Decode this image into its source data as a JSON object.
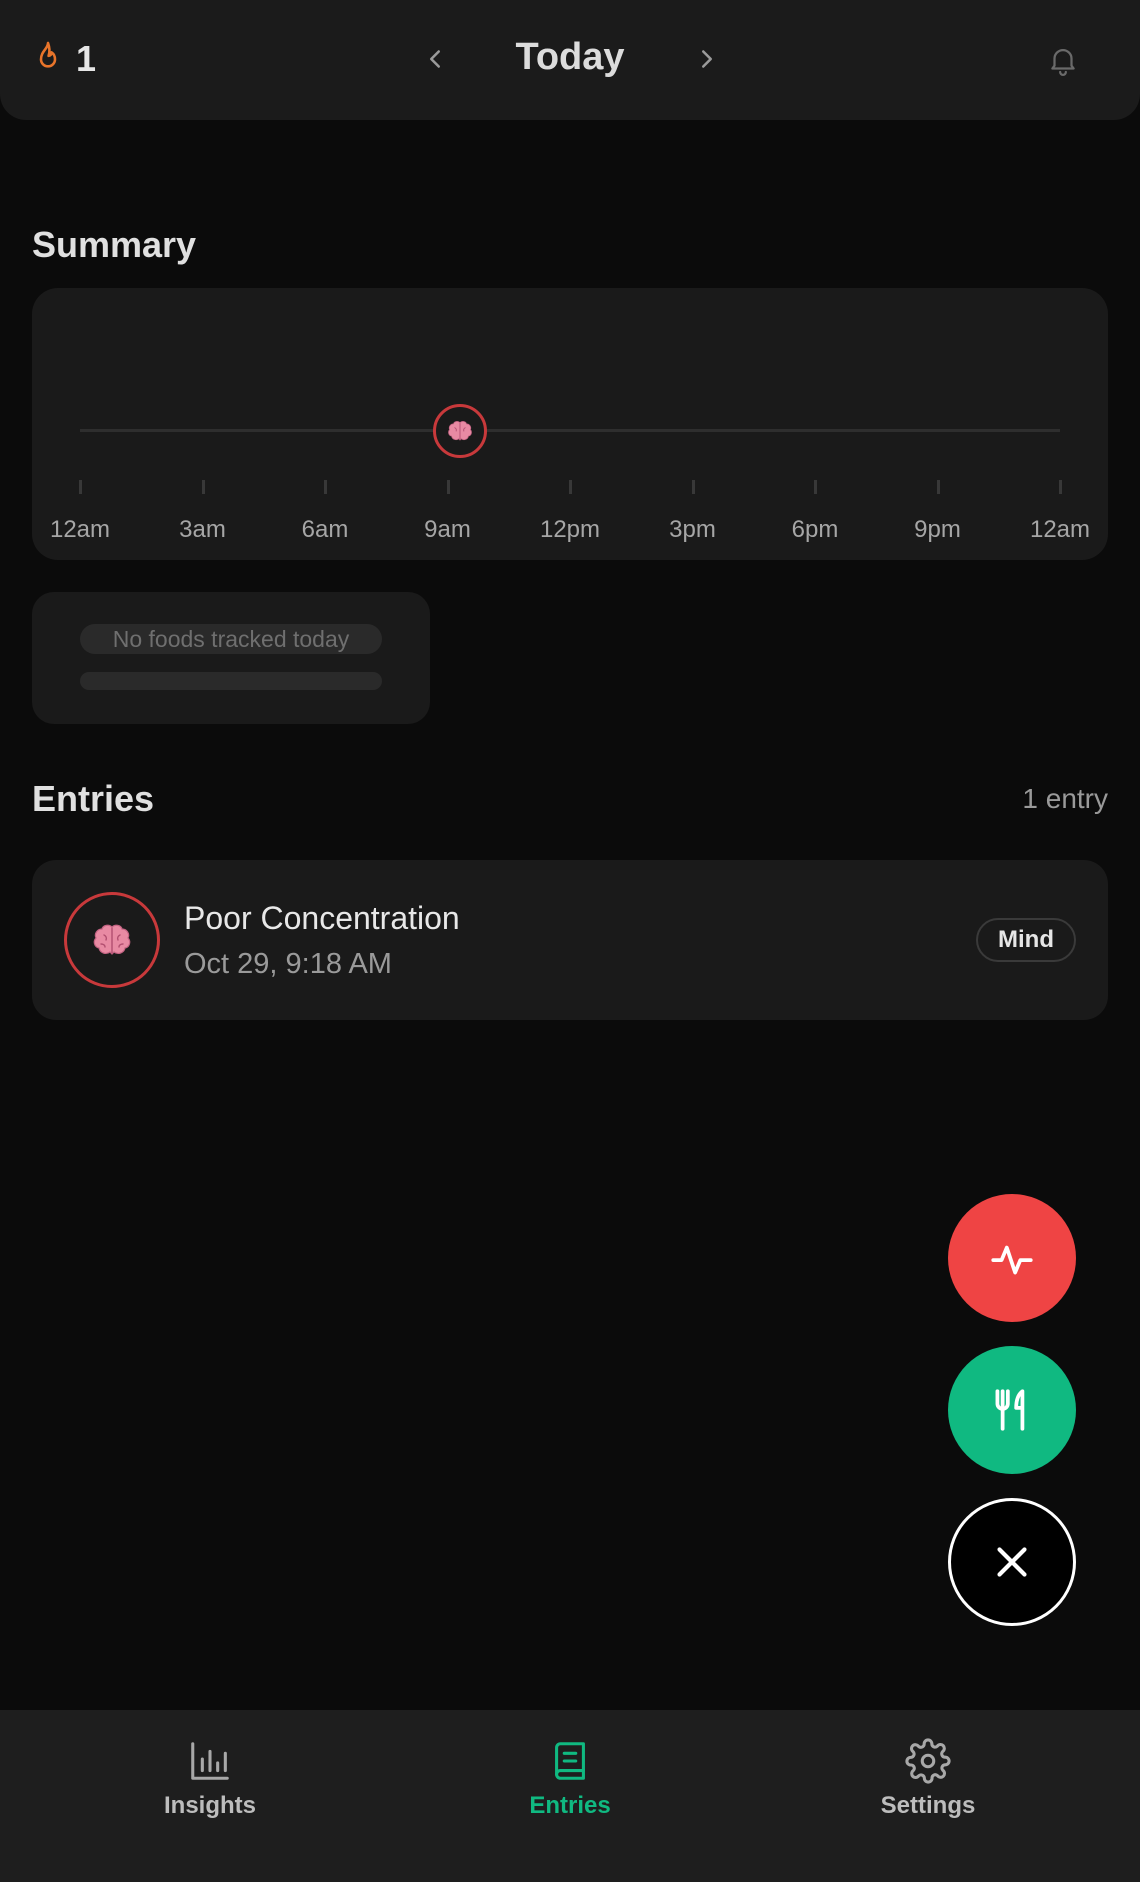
{
  "header": {
    "streak_count": "1",
    "title": "Today"
  },
  "summary": {
    "title": "Summary",
    "timeline_labels": [
      "12am",
      "3am",
      "6am",
      "9am",
      "12pm",
      "3pm",
      "6pm",
      "9pm",
      "12am"
    ],
    "events": [
      {
        "category": "Mind",
        "time_of_day_hours": 9.3,
        "icon": "brain-icon"
      }
    ]
  },
  "foods": {
    "empty_text": "No foods tracked today"
  },
  "entries": {
    "title": "Entries",
    "count_label": "1 entry",
    "items": [
      {
        "title": "Poor Concentration",
        "time": "Oct 29, 9:18 AM",
        "tag": "Mind",
        "icon": "brain-icon"
      }
    ]
  },
  "fabs": {
    "symptom_icon": "pulse-icon",
    "food_icon": "utensils-icon",
    "close_icon": "close-icon"
  },
  "bottom_nav": {
    "items": [
      {
        "label": "Insights",
        "icon": "bar-chart-icon",
        "active": false
      },
      {
        "label": "Entries",
        "icon": "book-icon",
        "active": true
      },
      {
        "label": "Settings",
        "icon": "gear-icon",
        "active": false
      }
    ]
  },
  "colors": {
    "background": "#0b0b0b",
    "card": "#1a1a1a",
    "accent_green": "#10b981",
    "accent_red": "#ef4444",
    "marker_red": "#c8393b",
    "streak_orange": "#e8742a"
  }
}
